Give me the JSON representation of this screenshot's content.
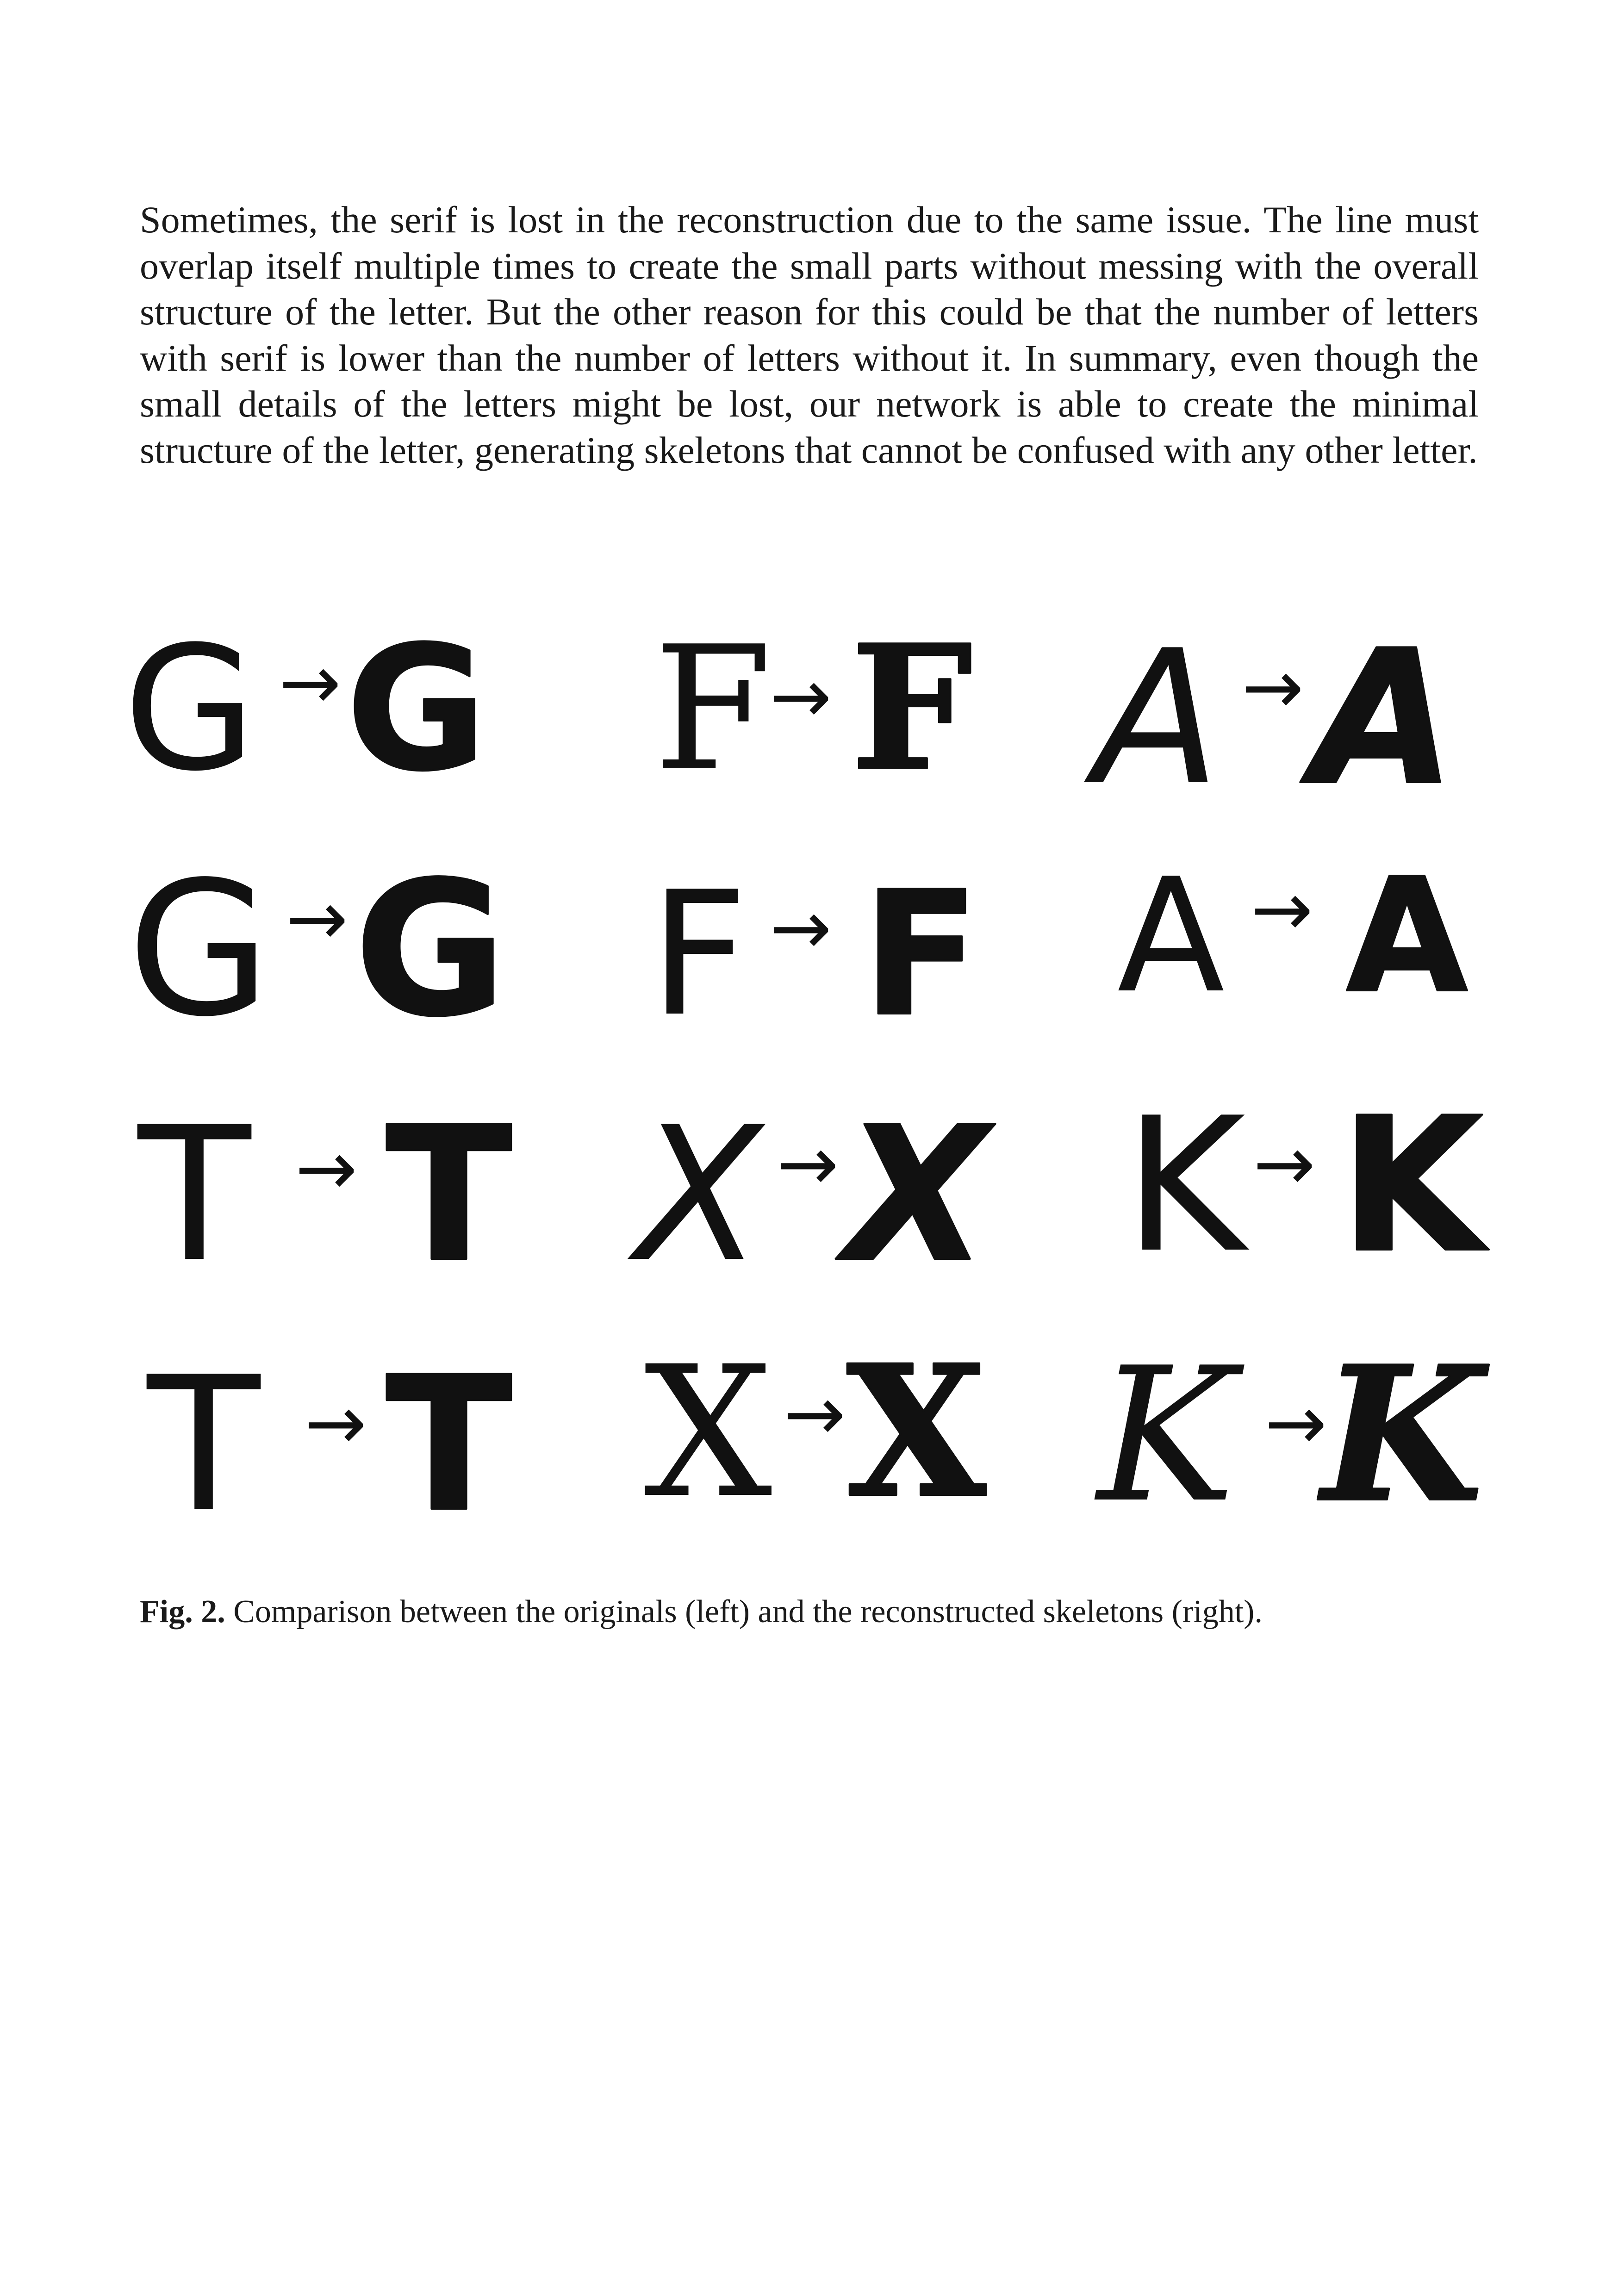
{
  "paragraph": "Sometimes, the serif is lost in the reconstruction due to the same issue. The line must overlap itself multiple times to create the small parts without messing with the overall structure of the letter. But the other reason for this could be that the number of letters with serif is lower than the number of letters without it. In summary, even though the small details of the letters might be lost, our network is able to create the minimal structure of the letter, generating skeletons that cannot be confused with any other letter.",
  "figure": {
    "arrow": "→",
    "rows": [
      [
        {
          "original": "G",
          "reconstructed": "G"
        },
        {
          "original": "F",
          "reconstructed": "F"
        },
        {
          "original": "A",
          "reconstructed": "A"
        }
      ],
      [
        {
          "original": "G",
          "reconstructed": "G"
        },
        {
          "original": "F",
          "reconstructed": "F"
        },
        {
          "original": "A",
          "reconstructed": "A"
        }
      ],
      [
        {
          "original": "T",
          "reconstructed": "T"
        },
        {
          "original": "X",
          "reconstructed": "X"
        },
        {
          "original": "K",
          "reconstructed": "K"
        }
      ],
      [
        {
          "original": "T",
          "reconstructed": "T"
        },
        {
          "original": "X",
          "reconstructed": "X"
        },
        {
          "original": "K",
          "reconstructed": "K"
        }
      ]
    ]
  },
  "caption": {
    "label": "Fig. 2.",
    "text": " Comparison between the originals (left) and the reconstructed skeletons (right)."
  }
}
